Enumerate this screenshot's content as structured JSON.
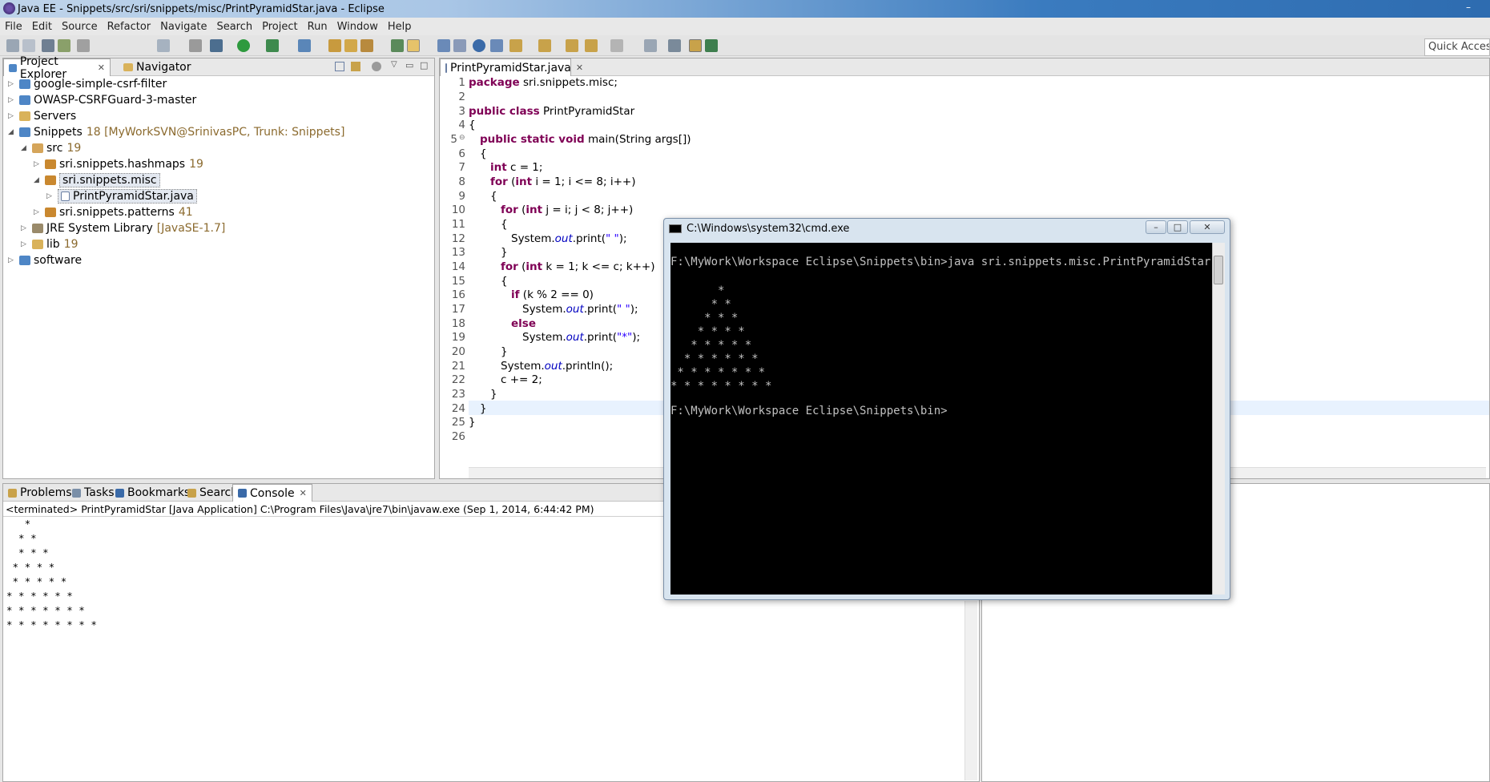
{
  "window": {
    "title": "Java EE - Snippets/src/sri/snippets/misc/PrintPyramidStar.java - Eclipse",
    "minimize": "–"
  },
  "menu": [
    "File",
    "Edit",
    "Source",
    "Refactor",
    "Navigate",
    "Search",
    "Project",
    "Run",
    "Window",
    "Help"
  ],
  "quick_access": "Quick Access",
  "explorer": {
    "tabs": [
      {
        "label": "Project Explorer",
        "close": "✕"
      },
      {
        "label": "Navigator"
      }
    ],
    "tree": [
      {
        "twisty": "▷",
        "label": "google-simple-csrf-filter",
        "dec": ""
      },
      {
        "twisty": "▷",
        "label": "OWASP-CSRFGuard-3-master",
        "dec": ""
      },
      {
        "twisty": "▷",
        "label": "Servers",
        "dec": ""
      },
      {
        "twisty": "◢",
        "label": "Snippets",
        "dec": "18 [MyWorkSVN@SrinivasPC, Trunk: Snippets]"
      },
      {
        "twisty": "◢",
        "label": "src",
        "dec": "19"
      },
      {
        "twisty": "▷",
        "label": "sri.snippets.hashmaps",
        "dec": "19"
      },
      {
        "twisty": "◢",
        "label": "sri.snippets.misc",
        "dec": ""
      },
      {
        "twisty": "▷",
        "label": "PrintPyramidStar.java",
        "dec": ""
      },
      {
        "twisty": "▷",
        "label": "sri.snippets.patterns",
        "dec": "41"
      },
      {
        "twisty": "▷",
        "label": "JRE System Library",
        "dec": "[JavaSE-1.7]"
      },
      {
        "twisty": "▷",
        "label": "lib",
        "dec": "19"
      },
      {
        "twisty": "▷",
        "label": "software",
        "dec": ""
      }
    ]
  },
  "editor": {
    "tab": "PrintPyramidStar.java",
    "tab_close": "✕",
    "code": {
      "l1_kw": "package",
      "l1_rest": " sri.snippets.misc;",
      "l3_kw": "public class",
      "l3_rest": " PrintPyramidStar",
      "l4": "{",
      "l5_kw": "public static void",
      "l5_rest": " main(String args[])",
      "l6": "{",
      "l7_kw": "int",
      "l7_rest": " c = 1;",
      "l8_kw1": "for",
      "l8_mid": " (",
      "l8_kw2": "int",
      "l8_rest": " i = 1; i <= 8; i++)",
      "l9": "{",
      "l10_kw1": "for",
      "l10_mid": " (",
      "l10_kw2": "int",
      "l10_rest": " j = i; j < 8; j++)",
      "l11": "{",
      "l12_a": "System.",
      "l12_fld": "out",
      "l12_b": ".print(",
      "l12_str": "\" \"",
      "l12_c": ");",
      "l13": "}",
      "l14_kw1": "for",
      "l14_mid": " (",
      "l14_kw2": "int",
      "l14_rest": " k = 1; k <= c; k++)",
      "l15": "{",
      "l16_kw": "if",
      "l16_rest": " (k % 2 == 0)",
      "l17_a": "System.",
      "l17_fld": "out",
      "l17_b": ".print(",
      "l17_str": "\" \"",
      "l17_c": ");",
      "l18_kw": "else",
      "l19_a": "System.",
      "l19_fld": "out",
      "l19_b": ".print(",
      "l19_str": "\"*\"",
      "l19_c": ");",
      "l20": "}",
      "l21_a": "System.",
      "l21_fld": "out",
      "l21_b": ".println();",
      "l22": "c += 2;",
      "l23": "}",
      "l24": "}",
      "l25": "}"
    }
  },
  "console": {
    "tabs": [
      "Problems",
      "Tasks",
      "Bookmarks",
      "Search",
      "Console"
    ],
    "console_close": "✕",
    "header": "<terminated> PrintPyramidStar [Java Application] C:\\Program Files\\Java\\jre7\\bin\\javaw.exe (Sep 1, 2014, 6:44:42 PM)",
    "output": [
      "   *",
      "  * *",
      "  * * *",
      " * * * *",
      " * * * * *",
      "* * * * * *",
      "* * * * * * *",
      "* * * * * * * *"
    ]
  },
  "cmd": {
    "title": "C:\\Windows\\system32\\cmd.exe",
    "buttons": {
      "min": "–",
      "max": "□",
      "close": "✕"
    },
    "prompt_cmd": "F:\\MyWork\\Workspace Eclipse\\Snippets\\bin>java sri.snippets.misc.PrintPyramidStar",
    "pyramid": [
      "       *",
      "      * *",
      "     * * *",
      "    * * * *",
      "   * * * * *",
      "  * * * * * *",
      " * * * * * * *",
      "* * * * * * * *"
    ],
    "prompt_end": "F:\\MyWork\\Workspace Eclipse\\Snippets\\bin>"
  }
}
